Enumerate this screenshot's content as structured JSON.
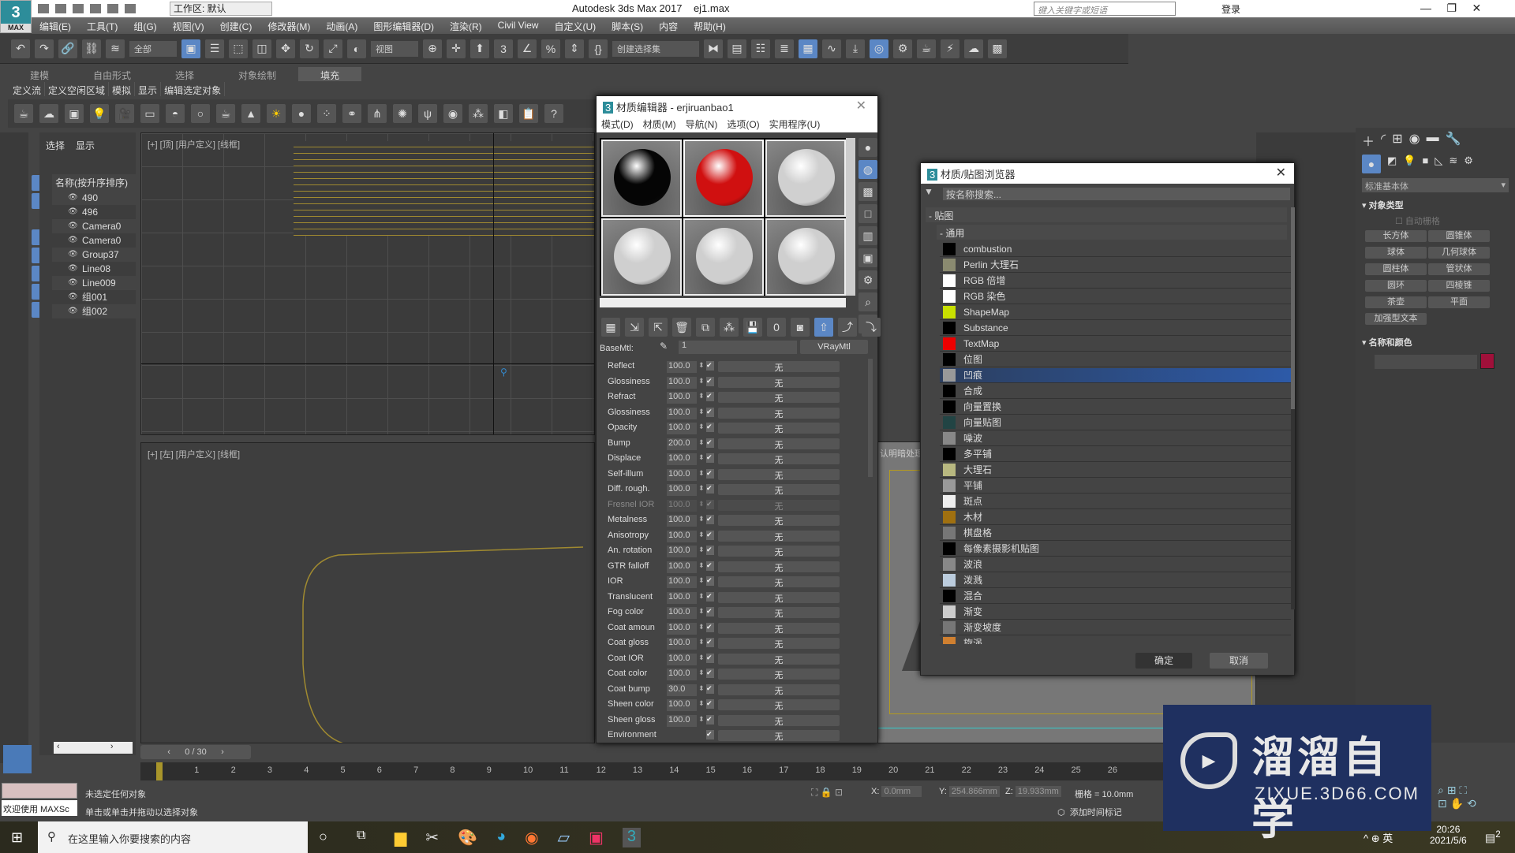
{
  "app": {
    "title": "Autodesk 3ds Max 2017",
    "file": "ej1.max",
    "logo": "3",
    "logo_sub": "MAX",
    "workspace": "工作区: 默认",
    "search_placeholder": "键入关键字或短语",
    "login": "登录"
  },
  "menu": [
    "编辑(E)",
    "工具(T)",
    "组(G)",
    "视图(V)",
    "创建(C)",
    "修改器(M)",
    "动画(A)",
    "图形编辑器(D)",
    "渲染(R)",
    "Civil View",
    "自定义(U)",
    "脚本(S)",
    "内容",
    "帮助(H)"
  ],
  "toolbar": {
    "filter": "全部",
    "refcoord": "视图",
    "selset": "创建选择集",
    "snap1": "3",
    "snap2": "%"
  },
  "ribbon": {
    "tabs": [
      "建模",
      "自由形式",
      "选择",
      "对象绘制",
      "填充"
    ],
    "active": 4,
    "sub": [
      "定义流",
      "定义空闲区域",
      "模拟",
      "显示",
      "编辑选定对象"
    ]
  },
  "explorer": {
    "tabs": [
      "选择",
      "显示"
    ],
    "header": "名称(按升序排序)",
    "items": [
      "490",
      "496",
      "Camera0",
      "Camera0",
      "Group37",
      "Line08",
      "Line009",
      "组001",
      "组002"
    ],
    "scroll_label": "0 / 30"
  },
  "viewports": {
    "top": "[+] [顶] [用户定义] [线框]",
    "left": "[+] [左] [用户定义] [线框]",
    "persp_text": "认明暗处理"
  },
  "mat_editor": {
    "title": "材质编辑器 - erjiruanbao1",
    "menu": [
      "模式(D)",
      "材质(M)",
      "导航(N)",
      "选项(O)",
      "实用程序(U)"
    ],
    "basemtl_label": "BaseMtl:",
    "mtl_name": "1",
    "mtl_type": "VRayMtl",
    "spheres": [
      "#050505",
      "#d01010",
      "#d0d0d0",
      "#cfcfcf",
      "#cfcfcf",
      "#cfcfcf"
    ],
    "selected_slot": 1,
    "params": [
      {
        "label": "Reflect",
        "value": "100.0",
        "map": "无"
      },
      {
        "label": "Glossiness",
        "value": "100.0",
        "map": "无"
      },
      {
        "label": "Refract",
        "value": "100.0",
        "map": "无"
      },
      {
        "label": "Glossiness",
        "value": "100.0",
        "map": "无"
      },
      {
        "label": "Opacity",
        "value": "100.0",
        "map": "无"
      },
      {
        "label": "Bump",
        "value": "200.0",
        "map": "无"
      },
      {
        "label": "Displace",
        "value": "100.0",
        "map": "无"
      },
      {
        "label": "Self-illum",
        "value": "100.0",
        "map": "无"
      },
      {
        "label": "Diff. rough.",
        "value": "100.0",
        "map": "无"
      },
      {
        "label": "Fresnel IOR",
        "value": "100.0",
        "map": "无",
        "disabled": true
      },
      {
        "label": "Metalness",
        "value": "100.0",
        "map": "无"
      },
      {
        "label": "Anisotropy",
        "value": "100.0",
        "map": "无"
      },
      {
        "label": "An. rotation",
        "value": "100.0",
        "map": "无"
      },
      {
        "label": "GTR falloff",
        "value": "100.0",
        "map": "无"
      },
      {
        "label": "IOR",
        "value": "100.0",
        "map": "无"
      },
      {
        "label": "Translucent",
        "value": "100.0",
        "map": "无"
      },
      {
        "label": "Fog color",
        "value": "100.0",
        "map": "无"
      },
      {
        "label": "Coat amoun",
        "value": "100.0",
        "map": "无"
      },
      {
        "label": "Coat gloss",
        "value": "100.0",
        "map": "无"
      },
      {
        "label": "Coat IOR",
        "value": "100.0",
        "map": "无"
      },
      {
        "label": "Coat color",
        "value": "100.0",
        "map": "无"
      },
      {
        "label": "Coat bump",
        "value": "30.0",
        "map": "无"
      },
      {
        "label": "Sheen color",
        "value": "100.0",
        "map": "无"
      },
      {
        "label": "Sheen gloss",
        "value": "100.0",
        "map": "无"
      },
      {
        "label": "Environment",
        "value": "",
        "map": "无"
      }
    ]
  },
  "browser": {
    "title": "材质/贴图浏览器",
    "search_placeholder": "按名称搜索...",
    "group": "- 贴图",
    "subgroup": "- 通用",
    "ok": "确定",
    "cancel": "取消",
    "selected": 8,
    "items": [
      {
        "name": "combustion",
        "swatch": "#000"
      },
      {
        "name": "Perlin 大理石",
        "swatch": "#8a8a70"
      },
      {
        "name": "RGB 倍增",
        "swatch": "#fff"
      },
      {
        "name": "RGB 染色",
        "swatch": "#fff"
      },
      {
        "name": "ShapeMap",
        "swatch": "#c8e000"
      },
      {
        "name": "Substance",
        "swatch": "#000"
      },
      {
        "name": "TextMap",
        "swatch": "#e00"
      },
      {
        "name": "位图",
        "swatch": "#000"
      },
      {
        "name": "凹痕",
        "swatch": "#999"
      },
      {
        "name": "合成",
        "swatch": "#000"
      },
      {
        "name": "向量置换",
        "swatch": "#000"
      },
      {
        "name": "向量贴图",
        "swatch": "#244"
      },
      {
        "name": "噪波",
        "swatch": "#888"
      },
      {
        "name": "多平铺",
        "swatch": "#000"
      },
      {
        "name": "大理石",
        "swatch": "#b8b880"
      },
      {
        "name": "平铺",
        "swatch": "#999"
      },
      {
        "name": "斑点",
        "swatch": "#eee"
      },
      {
        "name": "木材",
        "swatch": "#a07010"
      },
      {
        "name": "棋盘格",
        "swatch": "#777"
      },
      {
        "name": "每像素摄影机贴图",
        "swatch": "#000"
      },
      {
        "name": "波浪",
        "swatch": "#888"
      },
      {
        "name": "泼溅",
        "swatch": "#bcd"
      },
      {
        "name": "混合",
        "swatch": "#000"
      },
      {
        "name": "渐变",
        "swatch": "#ccc"
      },
      {
        "name": "渐变坡度",
        "swatch": "#777"
      },
      {
        "name": "旋涡",
        "swatch": "#d08030"
      }
    ]
  },
  "command_panel": {
    "category": "标准基本体",
    "rollout1": "对象类型",
    "autogrid": "自动栅格",
    "buttons": [
      "长方体",
      "圆锥体",
      "球体",
      "几何球体",
      "圆柱体",
      "管状体",
      "圆环",
      "四棱锥",
      "茶壶",
      "平面",
      "加强型文本"
    ],
    "rollout2": "名称和颜色",
    "color": "#a0103a"
  },
  "timeline": {
    "ticks": [
      "0",
      "1",
      "2",
      "3",
      "4",
      "5",
      "6",
      "7",
      "8",
      "9",
      "10",
      "11",
      "12",
      "13",
      "14",
      "15",
      "16",
      "17",
      "18",
      "19",
      "20",
      "21",
      "22",
      "23",
      "24",
      "25",
      "26"
    ]
  },
  "status": {
    "line1": "未选定任何对象",
    "line2": "单击或单击并拖动以选择对象",
    "maxscript": "欢迎使用 MAXSc",
    "x_label": "X:",
    "x": "0.0mm",
    "y_label": "Y:",
    "y": "254.866mm",
    "z_label": "Z:",
    "z": "19.933mm",
    "grid": "栅格 = 10.0mm",
    "add_tag": "添加时间标记"
  },
  "taskbar": {
    "search": "在这里输入你要搜索的内容",
    "time": "20:26",
    "date": "2021/5/6",
    "ime": "英",
    "notif": "2"
  },
  "watermark": {
    "brand": "溜溜自学",
    "url": "ZIXUE.3D66.COM"
  }
}
